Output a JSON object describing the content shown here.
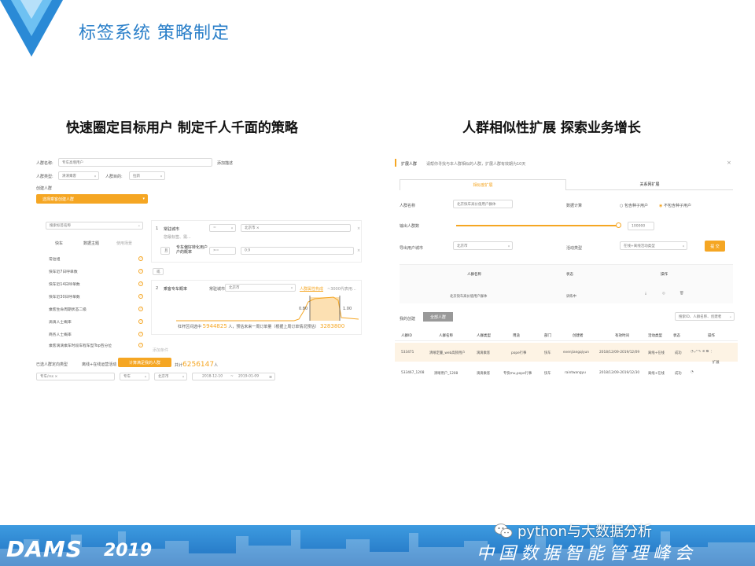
{
  "slide": {
    "title": "标签系统 策略制定",
    "left_heading": "快速圈定目标用户  制定千人千面的策略",
    "right_heading": "人群相似性扩展   探索业务增长"
  },
  "left_panel": {
    "crowd_name_label": "人群名称:",
    "crowd_name_value": "专车高增用户",
    "add_desc": "添加描述",
    "crowd_type_label": "人群类型:",
    "crowd_type_value": "清清乘客",
    "crowd_purpose_label": "人群目的:",
    "crowd_purpose_value": "拉新",
    "create_label": "创建人群",
    "select_button": "选择乘客创建人群",
    "search_placeholder": "搜索标签名称",
    "filter_a": "快车",
    "filter_b": "数据主题",
    "filter_c": "使用场景",
    "tag_list": [
      "常驻组",
      "快车近7日呼单数",
      "快车近14日呼单数",
      "快车近30日呼单数",
      "乘客生命周期状态二级",
      "滴滴人士概率",
      "商务人士概率",
      "乘客滴滴乘车时段车程车型Top百分位"
    ],
    "cond1_index": "1",
    "cond1_label": "常驻城市",
    "cond1_op": "=",
    "cond1_value": "北京市 ×",
    "cond1_extra": "您最标签、需...",
    "cond1_and": "且",
    "cond1_sub_label": "专车偏好转化用户户的概率",
    "cond1_sub_op": ">=",
    "cond1_sub_value": "0.9",
    "or_label": "或",
    "cond2_index": "2",
    "cond2_label": "乘客专车概率",
    "cond2_city_label": "常驻城市",
    "cond2_city_value": "北京市",
    "cond2_link": "人群属性构成",
    "cond2_link_note": "~3000代表用...",
    "slider_left": "0.80",
    "slider_right": "1.00",
    "result_prefix": "杠杆区间选中",
    "result_count": "5944825",
    "result_suffix": "人，预估未来一周订单量（根据上周订单情况预估）",
    "result_orders": "3283800",
    "add_condition": "添加条件",
    "selected_type_label": "已选人群定向类型",
    "selected_type_value": "离线+在线运营活动",
    "calc_button": "计算满足我的人群",
    "total_prefix": "共计",
    "total_count": "6256147",
    "total_suffix": "人",
    "bottom_select_a": "专车/rss ×",
    "bottom_select_b": "专车",
    "bottom_select_c": "北京市",
    "date_from": "2018-12-10",
    "date_sep": "~",
    "date_to": "2019-01-09"
  },
  "right_panel": {
    "title": "扩展人群",
    "hint": "请帮你寻找与本人群相似的人群，扩展人群有效期为10天",
    "close": "×",
    "tab_active": "相似度扩展",
    "tab_inactive": "关系网扩展",
    "crowd_name_label": "人群名称",
    "crowd_name_value": "北京快车高价值用户群体",
    "data_calc_label": "数据计算",
    "radio_a": "包含种子用户",
    "radio_b": "不包含种子用户",
    "output_label": "输出人群数",
    "output_value": "100000",
    "city_label": "导出用户城市",
    "city_value": "北京市",
    "activity_label": "活动类型",
    "activity_value": "在线+离线活动类型",
    "submit": "提 交",
    "table_head": [
      "人群名称",
      "状态",
      "操作"
    ],
    "table_row": [
      "北京快车高价值用户群体",
      "训练中"
    ],
    "sub_tab_a": "我的创建",
    "sub_tab_b": "全部人群",
    "search_placeholder": "搜索ID、人群名称、创建者",
    "list_head": [
      "人群ID",
      "人群名称",
      "人群类型",
      "用途",
      "部门",
      "创建者",
      "有效时间",
      "活动类型",
      "状态",
      "操作"
    ],
    "rows": [
      [
        "533471",
        "清晰定量_web高频用户",
        "滴滴乘客",
        "pope行事",
        "快车",
        "evenjiangqiyun",
        "2018/12/09-2019/12/09",
        "离线+在线",
        "成功"
      ],
      [
        "533467_1208",
        "清晰用户_1208",
        "滴滴乘客",
        "专快mu,pope行事",
        "快车",
        "raintwangyu",
        "2018/12/09-2019/12/30",
        "离线+在线",
        "成功"
      ]
    ],
    "dropdown_item": "扩展"
  },
  "footer": {
    "logo": "DAMS",
    "year": "2019",
    "slogan": "中国数据智能管理峰会",
    "watermark": "python与大数据分析"
  },
  "colors": {
    "accent": "#2a7fc9",
    "orange": "#f5a623",
    "footer": "#1f6fbf"
  }
}
